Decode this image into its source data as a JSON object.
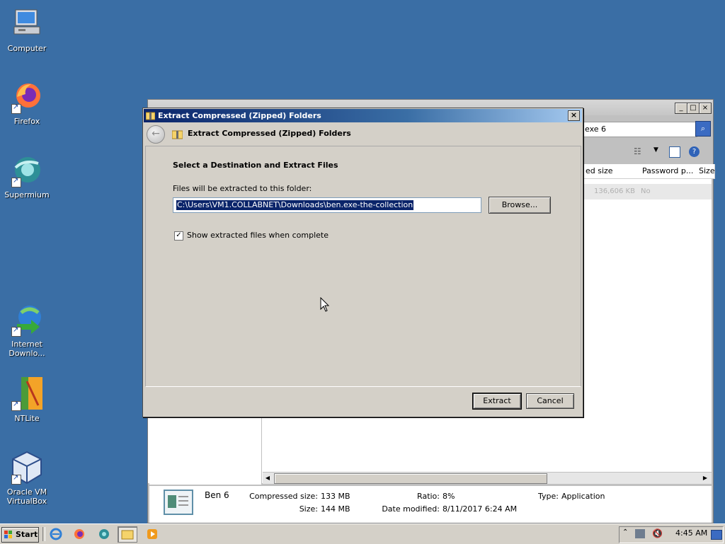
{
  "desktop": {
    "icons": [
      {
        "label": "Computer",
        "icon": "computer-icon"
      },
      {
        "label": "Firefox",
        "icon": "firefox-icon"
      },
      {
        "label": "Supermium",
        "icon": "supermium-icon"
      },
      {
        "label": "Internet Downlo...",
        "icon": "internet-download-manager-icon"
      },
      {
        "label": "NTLite",
        "icon": "ntlite-icon"
      },
      {
        "label": "Oracle VM VirtualBox",
        "icon": "virtualbox-icon"
      }
    ]
  },
  "explorer": {
    "search_value": "exe 6",
    "columns": [
      "ed size",
      "Password p...",
      "Size"
    ],
    "row": {
      "compressed": "136,606 KB",
      "password": "No"
    },
    "details": {
      "name": "Ben 6",
      "compressed_size_label": "Compressed size:",
      "compressed_size": "133 MB",
      "size_label": "Size:",
      "size": "144 MB",
      "ratio_label": "Ratio:",
      "ratio": "8%",
      "date_label": "Date modified:",
      "date": "8/11/2017 6:24 AM",
      "type_label": "Type:",
      "type": "Application"
    }
  },
  "dialog": {
    "title": "Extract Compressed (Zipped) Folders",
    "header_title": "Extract Compressed (Zipped) Folders",
    "section_title": "Select a Destination and Extract Files",
    "path_label": "Files will be extracted to this folder:",
    "path_value": "C:\\Users\\VM1.COLLABNET\\Downloads\\ben.exe-the-collection",
    "browse_label": "Browse...",
    "checkbox_label": "Show extracted files when complete",
    "checkbox_checked": true,
    "extract_label": "Extract",
    "cancel_label": "Cancel"
  },
  "taskbar": {
    "start_label": "Start",
    "clock": "4:45 AM"
  },
  "colors": {
    "desktop": "#3a6ea5",
    "dialog_face": "#d4d0c8",
    "title_active": "#0a246a",
    "selection": "#0a246a"
  }
}
